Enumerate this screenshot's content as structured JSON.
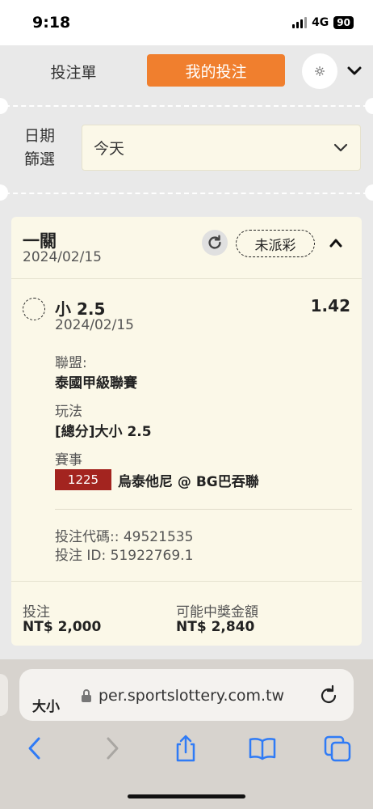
{
  "status_bar": {
    "time": "9:18",
    "network": "4G",
    "battery": "90"
  },
  "header": {
    "tab_betslip": "投注單",
    "tab_mybets": "我的投注",
    "settings_icon": "gear-icon",
    "menu_icon": "chevron-down-icon"
  },
  "filter": {
    "label": "日期篩選",
    "value": "今天"
  },
  "bet": {
    "type": "一關",
    "date": "2024/02/15",
    "status": "未派彩",
    "selection": {
      "name": "小 2.5",
      "date": "2024/02/15",
      "odds": "1.42"
    },
    "league_label": "聯盟:",
    "league_value": "泰國甲級聯賽",
    "market_label": "玩法",
    "market_value": "[總分]大小 2.5",
    "event_label": "賽事",
    "match_code": "1225",
    "match_name": "烏泰他尼 @ BG巴吞聯",
    "bet_code": "投注代碼:: 49521535",
    "bet_id": "投注 ID: 51922769.1",
    "stake_label": "投注",
    "stake_value": "NT$ 2,000",
    "payout_label": "可能中獎金額",
    "payout_value": "NT$ 2,840"
  },
  "browser": {
    "page_title": "大小",
    "url": "per.sportslottery.com.tw"
  },
  "colors": {
    "accent": "#f07f2e",
    "card_bg": "#fbf8e8",
    "match_code_bg": "#a3241f",
    "ios_blue": "#2f7bf6"
  }
}
